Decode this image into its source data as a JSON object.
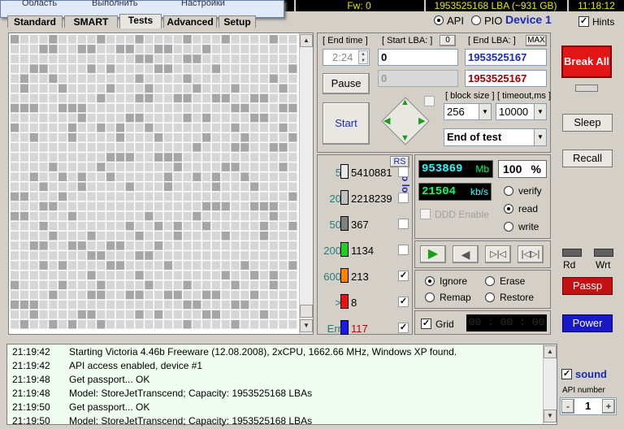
{
  "topbar": {
    "firmware": "Fw: 0",
    "lba": "1953525168 LBA (~931 GB)",
    "clock": "11:18:12"
  },
  "popup": {
    "item1": "Область",
    "item2": "Выполнить",
    "item3": "Настройки"
  },
  "tabs": [
    "Standard",
    "SMART",
    "Tests",
    "Advanced",
    "Setup"
  ],
  "active_tab": "Tests",
  "mode": {
    "api_label": "API",
    "pio_label": "PIO",
    "device_label": "Device 1",
    "hints_label": "Hints"
  },
  "lba_range": {
    "end_time_label": "[ End time ]",
    "end_time_value": "2:24",
    "start_lba_label": "[ Start LBA: ]",
    "start_lba_reset": "0",
    "start_lba_value": "0",
    "start_lba_current": "0",
    "end_lba_label": "[ End LBA: ]",
    "end_lba_max": "MAX",
    "end_lba_value": "1953525167",
    "end_lba_current": "1953525167"
  },
  "controls": {
    "pause_label": "Pause",
    "start_label": "Start",
    "block_size_label": "[ block size ]",
    "block_size_value": "256",
    "timeout_label": "[ timeout,ms ]",
    "timeout_value": "10000",
    "end_action_value": "End of test"
  },
  "counters": {
    "rs_label": "RS",
    "tolog_label": "to log:",
    "items": [
      {
        "label": "5",
        "value": "5410881",
        "color": "#e8e8e8",
        "log": false
      },
      {
        "label": "20",
        "value": "2218239",
        "color": "#c0c0c0",
        "log": false
      },
      {
        "label": "50",
        "value": "367",
        "color": "#808080",
        "log": false
      },
      {
        "label": "200",
        "value": "1134",
        "color": "#22cc22",
        "log": false
      },
      {
        "label": "600",
        "value": "213",
        "color": "#ff7f00",
        "log": true
      },
      {
        "label": ">",
        "value": "8",
        "color": "#ee1111",
        "log": true
      },
      {
        "label": "Err",
        "value": "117",
        "color": "#1a1aee",
        "log": true
      }
    ]
  },
  "stats": {
    "mb_value": "953869",
    "mb_unit": "Mb",
    "percent_value": "100",
    "percent_unit": "%",
    "speed_value": "21504",
    "speed_unit": "kb/s",
    "verify_label": "verify",
    "read_label": "read",
    "write_label": "write",
    "ddd_label": "DDD Enable"
  },
  "repair": {
    "ignore_label": "Ignore",
    "erase_label": "Erase",
    "remap_label": "Remap",
    "restore_label": "Restore",
    "grid_label": "Grid",
    "grid_time": "00 : 00 : 00"
  },
  "right_panel": {
    "break_all": "Break All",
    "sleep": "Sleep",
    "recall": "Recall",
    "rd": "Rd",
    "wrt": "Wrt",
    "passp": "Passp",
    "power": "Power",
    "sound_label": "sound",
    "api_number_label": "API number",
    "api_number_value": "1"
  },
  "log": [
    {
      "time": "21:19:42",
      "text": "Starting Victoria 4.46b Freeware (12.08.2008), 2xCPU, 1662.66 MHz, Windows XP found."
    },
    {
      "time": "21:19:42",
      "text": "API access enabled, device #1"
    },
    {
      "time": "21:19:48",
      "text": "Get passport... OK"
    },
    {
      "time": "21:19:48",
      "text": "Model: StoreJetTranscend; Capacity: 1953525168 LBAs"
    },
    {
      "time": "21:19:50",
      "text": "Get passport... OK"
    },
    {
      "time": "21:19:50",
      "text": "Model: StoreJetTranscend; Capacity: 1953525168 LBAs"
    }
  ],
  "colors": {
    "lcd_green": "#00ff66",
    "lcd_cyan": "#22ffff",
    "block_light": "#d6d6d6",
    "block_dark": "#a6a6a6",
    "device_blue": "#1a2ab8"
  }
}
